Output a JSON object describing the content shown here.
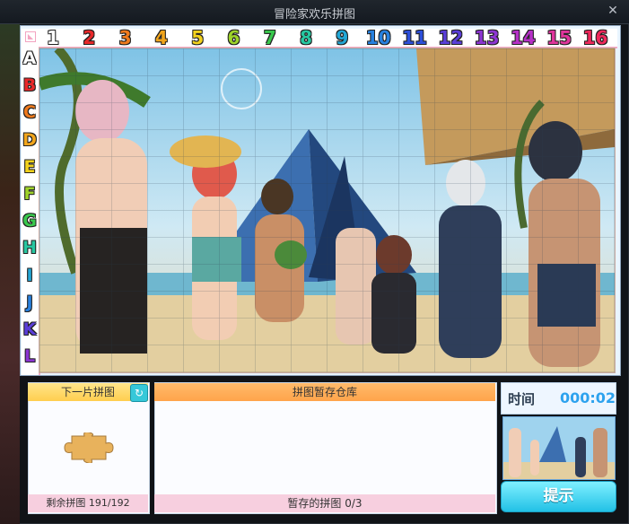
{
  "window": {
    "title": "冒险家欢乐拼图",
    "close_glyph": "✕"
  },
  "ruler": {
    "columns": [
      "1",
      "2",
      "3",
      "4",
      "5",
      "6",
      "7",
      "8",
      "9",
      "10",
      "11",
      "12",
      "13",
      "14",
      "15",
      "16"
    ],
    "column_colors": [
      "#ffffff",
      "#e8282a",
      "#f07a1c",
      "#f2a51b",
      "#f3d21c",
      "#9ed32a",
      "#39c84d",
      "#27c7a1",
      "#22a7d6",
      "#2781e0",
      "#2d4fda",
      "#5a3ed8",
      "#8c35d2",
      "#b730c8",
      "#e0359c",
      "#f0285b"
    ],
    "rows": [
      "A",
      "B",
      "C",
      "D",
      "E",
      "F",
      "G",
      "H",
      "I",
      "J",
      "K",
      "L"
    ],
    "row_colors": [
      "#ffffff",
      "#e8282a",
      "#f07a1c",
      "#f2a51b",
      "#f3d21c",
      "#9ed32a",
      "#39c84d",
      "#27c7a1",
      "#22a7d6",
      "#2781e0",
      "#5a3ed8",
      "#8c35d2"
    ]
  },
  "next_piece": {
    "header": "下一片拼图",
    "rotate_icon": "↻",
    "footer": "剩余拼图 191/192"
  },
  "storage": {
    "header": "拼图暂存仓库",
    "footer": "暂存的拼图 0/3"
  },
  "timer": {
    "label": "时间",
    "value": "000:02"
  },
  "hint_button": "提示"
}
